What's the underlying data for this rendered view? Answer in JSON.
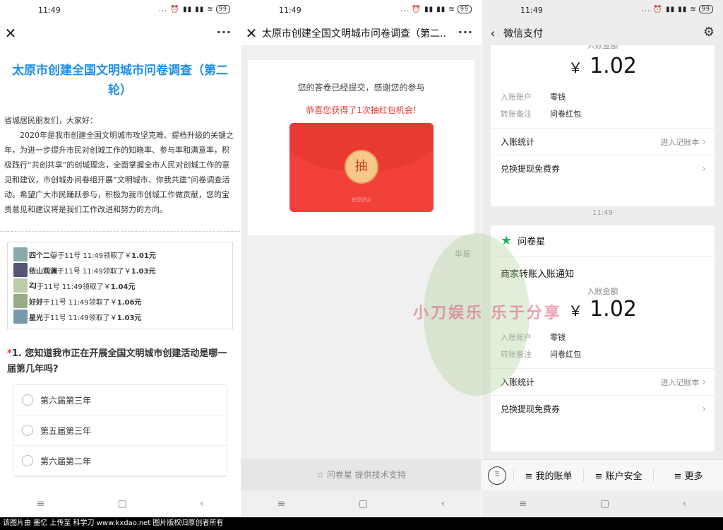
{
  "status": {
    "time": "11:49",
    "icons": "... ⏰ ▮▮ ▮▮ ≋",
    "battery": "99"
  },
  "screen1": {
    "title": "太原市创建全国文明城市问卷调查（第二轮）",
    "greeting": "省城居民朋友们，大家好：",
    "paragraph": "2020年是我市创建全国文明城市攻坚克难、提档升级的关键之年，为进一步提升市民对创城工作的知晓率、参与率和满意率，积极践行“共创共享”的创城理念，全面掌握全市人民对创城工作的意见和建议，市创城办问卷组开展“文明城市、你我共建”问卷调查活动。希望广大市民踊跃参与，积极为我市创城工作做贡献，您的宝贵意见和建议将是我们工作改进和努力的方向。",
    "winners": [
      {
        "name": "四个二😸",
        "text": "于11号 11:49领取了￥",
        "amount": "1.01元"
      },
      {
        "name": "依山观澜",
        "text": "于11号 11:49领取了￥",
        "amount": "1.03元"
      },
      {
        "name": "ZJ",
        "text": "于11号 11:49领取了￥",
        "amount": "1.04元"
      },
      {
        "name": "好好",
        "text": "于11号 11:49领取了￥",
        "amount": "1.06元"
      },
      {
        "name": "星光",
        "text": "于11号 11:49领取了￥",
        "amount": "1.03元"
      }
    ],
    "question": "1. 您知道我市正在开展全国文明城市创建活动是哪一届第几年吗?",
    "required_mark": "*",
    "options": [
      "第六届第三年",
      "第五届第三年",
      "第六届第二年"
    ]
  },
  "screen2": {
    "title": "太原市创建全国文明城市问卷调查（第二...",
    "submitted": "您的答卷已经提交，感谢您的参与",
    "lucky": "恭喜您获得了1次抽红包机会!",
    "draw": "抽",
    "slogan": "祝您好运",
    "report": "举报",
    "footer": "问卷星 提供技术支持"
  },
  "screen3": {
    "title": "微信支付",
    "top_card": {
      "amount_label": "入账金额",
      "amount": "1.02",
      "account_label": "入账账户",
      "account": "零钱",
      "note_label": "转账备注",
      "note": "问卷红包",
      "stats": "入账统计",
      "ledger": "进入记账本",
      "coupon": "兑换提现免费券"
    },
    "timestamp": "11:49",
    "brand": "问卷星",
    "notice": "商家转账入账通知",
    "card": {
      "amount_label": "入账金额",
      "amount": "1.02",
      "currency": "￥",
      "account_label": "入账账户",
      "account": "零钱",
      "note_label": "转账备注",
      "note": "问卷红包",
      "stats": "入账统计",
      "ledger": "进入记账本",
      "coupon": "兑换提现免费券"
    },
    "menu": [
      "≡ 我的账单",
      "≡ 账户安全",
      "≡ 更多"
    ]
  },
  "watermark": "小刀娱乐 乐于分享",
  "caption": "该图片由 墨忆 上传至 科学刀 www.kxdao.net 图片版权归原创者所有"
}
